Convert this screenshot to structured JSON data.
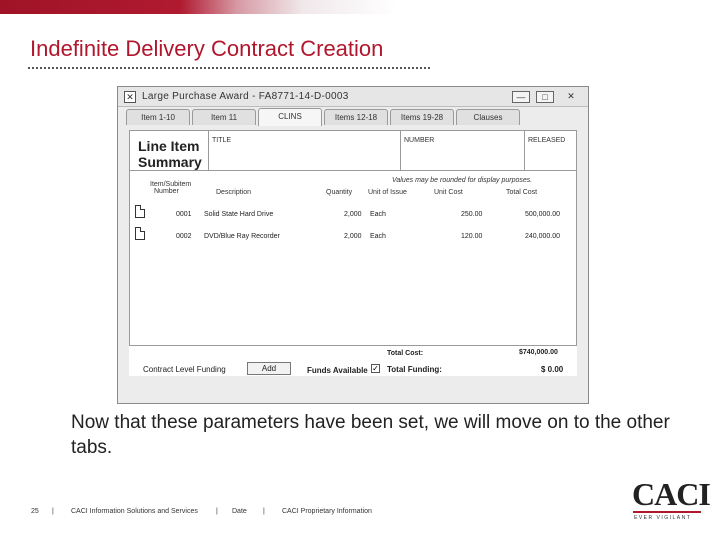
{
  "slide": {
    "title": "Indefinite Delivery Contract Creation",
    "caption": "Now that these parameters have been set, we will move on to the other tabs."
  },
  "window": {
    "title": "Large Purchase Award - FA8771-14-D-0003",
    "icon_glyph": "✕",
    "buttons": {
      "minimize": "—",
      "maximize": "□",
      "close": "✕"
    }
  },
  "tabs": [
    "Item 1-10",
    "Item 11",
    "CLINS",
    "Items 12-18",
    "Items 19-28",
    "Clauses"
  ],
  "active_tab": "CLINS",
  "summary": {
    "title_line1": "Line Item",
    "title_line2": "Summary",
    "header_title": "TITLE",
    "header_number": "NUMBER",
    "header_released": "RELEASED",
    "note": "Values may be rounded for display purposes.",
    "columns": {
      "item_line1": "Item/Subitem",
      "item_line2": "Number",
      "description": "Description",
      "quantity": "Quantity",
      "unit": "Unit of Issue",
      "unit_cost": "Unit Cost",
      "total_cost": "Total Cost"
    },
    "rows": [
      {
        "number": "0001",
        "description": "Solid State Hard Drive",
        "quantity": "2,000",
        "unit": "Each",
        "unit_cost": "250.00",
        "total_cost": "500,000.00"
      },
      {
        "number": "0002",
        "description": "DVD/Blue Ray Recorder",
        "quantity": "2,000",
        "unit": "Each",
        "unit_cost": "120.00",
        "total_cost": "240,000.00"
      }
    ]
  },
  "funding": {
    "contract_level_label": "Contract Level Funding",
    "add_label": "Add",
    "funds_available_label": "Funds Available",
    "funds_available_checked": true,
    "total_cost_label": "Total Cost:",
    "total_cost_value": "$740,000.00",
    "total_funding_label": "Total Funding:",
    "total_funding_value": "$ 0.00"
  },
  "footer": {
    "page_number": "25",
    "company": "CACI Information Solutions and Services",
    "date": "Date",
    "proprietary": "CACI Proprietary Information",
    "separator": "|"
  },
  "logo": {
    "name": "CACI",
    "tagline": "EVER VIGILANT"
  },
  "colors": {
    "brand_red": "#b0172d"
  }
}
